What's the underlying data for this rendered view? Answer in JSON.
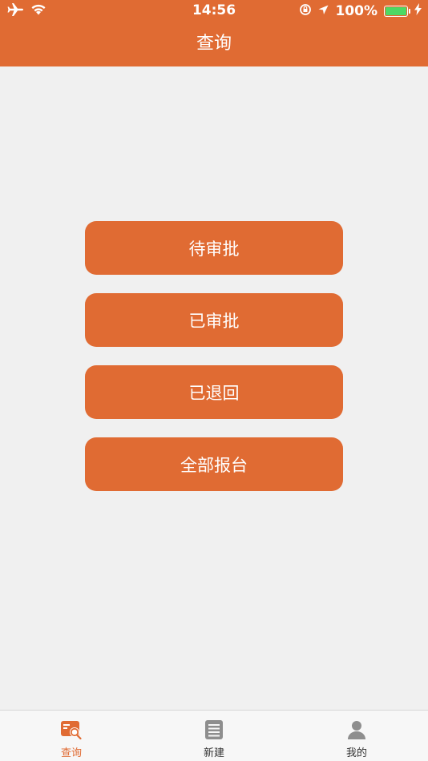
{
  "status_bar": {
    "time": "14:56",
    "battery_percent": "100%",
    "icons": [
      "airplane-icon",
      "wifi-icon",
      "rotation-lock-icon",
      "location-icon",
      "battery-icon",
      "charging-icon"
    ]
  },
  "header": {
    "title": "查询",
    "background": "#e06b33"
  },
  "menu": {
    "items": [
      {
        "label": "待审批"
      },
      {
        "label": "已审批"
      },
      {
        "label": "已退回"
      },
      {
        "label": "全部报台"
      }
    ],
    "button_color": "#e06b33"
  },
  "tabbar": {
    "tabs": [
      {
        "label": "查询",
        "icon": "search-document-icon",
        "active": true
      },
      {
        "label": "新建",
        "icon": "notepad-icon",
        "active": false
      },
      {
        "label": "我的",
        "icon": "user-icon",
        "active": false
      }
    ],
    "active_color": "#e06b33",
    "inactive_icon_color": "#8e8e8e"
  }
}
